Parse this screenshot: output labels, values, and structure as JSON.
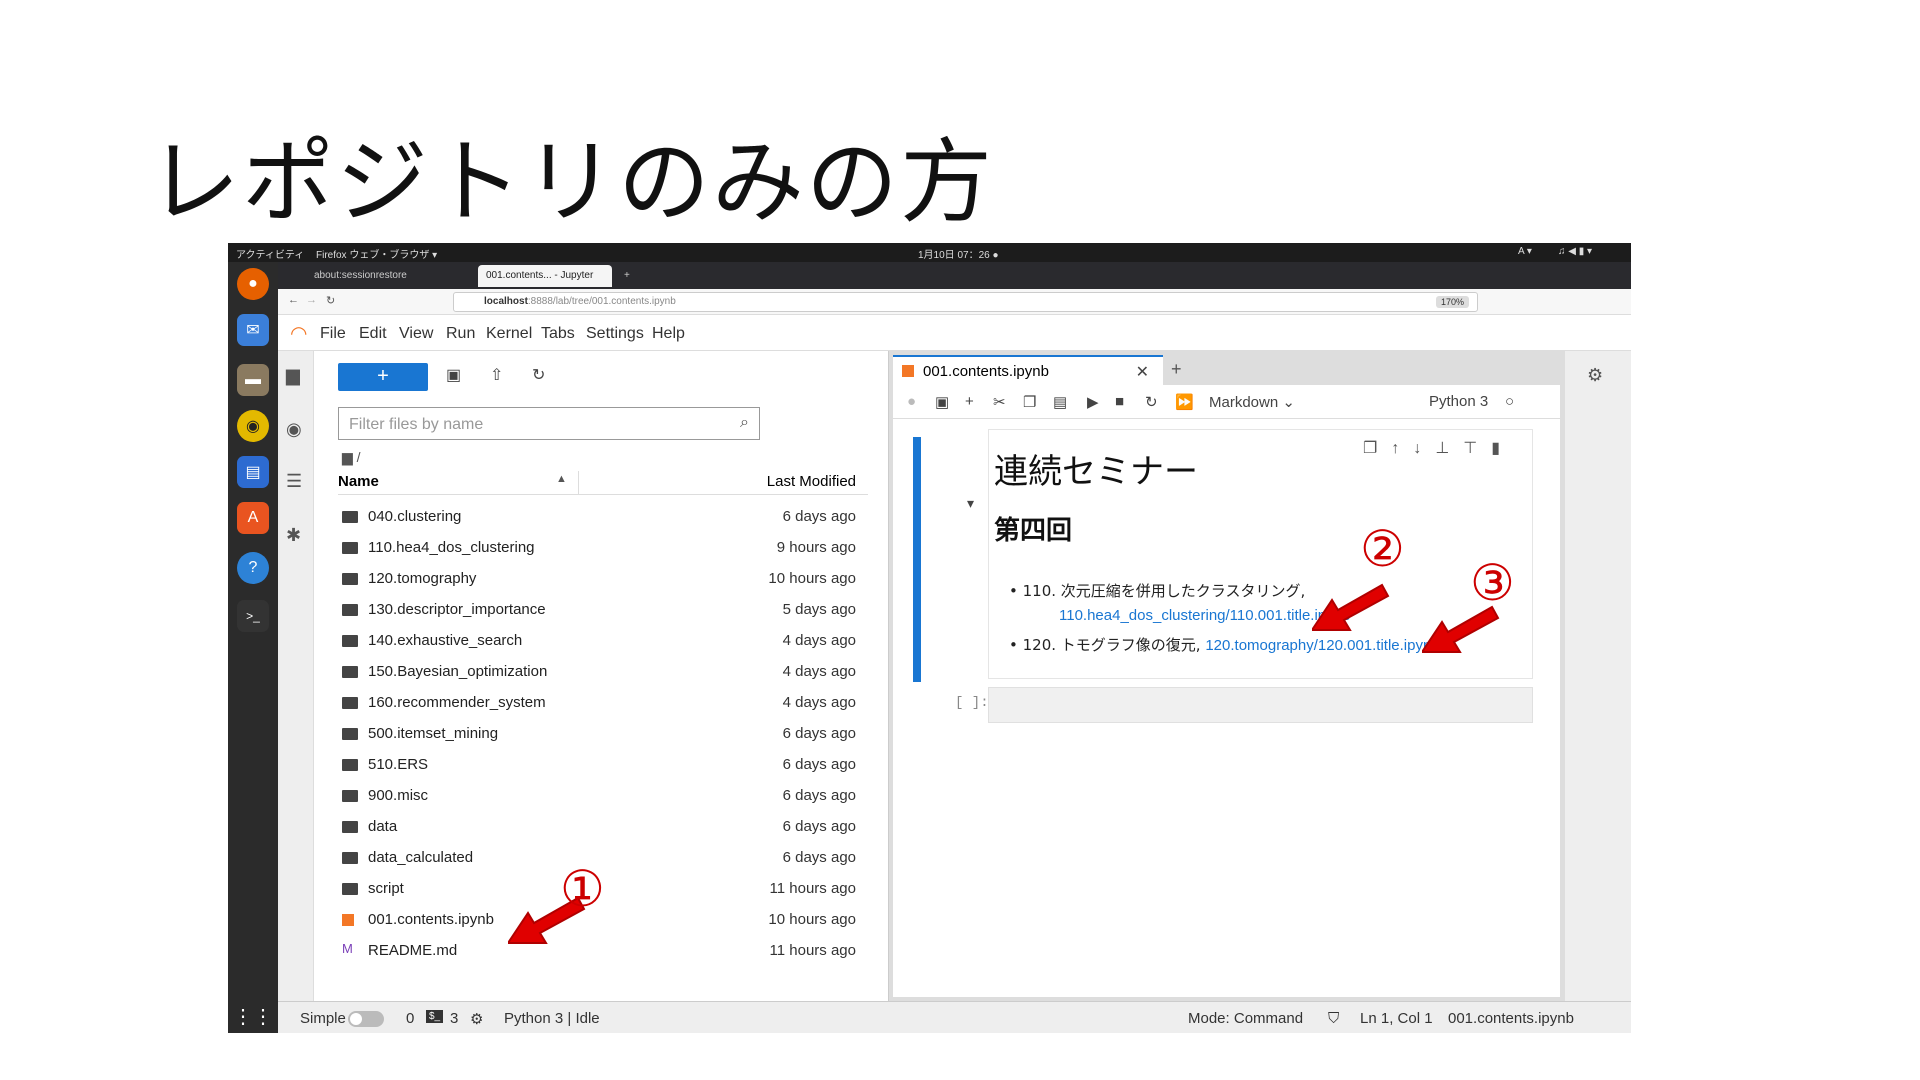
{
  "slide_title": "レポジトリのみの方",
  "gnome": {
    "activities": "アクティビティ",
    "app": "Firefox ウェブ・ブラウザ ▾",
    "clock": "1月10日 07：26 ●",
    "lang": "A ▾"
  },
  "firefox": {
    "tab1": "about:sessionrestore",
    "tab2": "001.contents... - Jupyter",
    "url_host": "localhost",
    "url_rest": ":8888/lab/tree/001.contents.ipynb",
    "zoom": "170%"
  },
  "menu": [
    "File",
    "Edit",
    "View",
    "Run",
    "Kernel",
    "Tabs",
    "Settings",
    "Help"
  ],
  "filebrowser": {
    "filter_placeholder": "Filter files by name",
    "crumb": "/",
    "col_name": "Name",
    "col_modified": "Last Modified",
    "rows": [
      {
        "name": "040.clustering",
        "date": "6 days ago",
        "type": "folder"
      },
      {
        "name": "110.hea4_dos_clustering",
        "date": "9 hours ago",
        "type": "folder"
      },
      {
        "name": "120.tomography",
        "date": "10 hours ago",
        "type": "folder"
      },
      {
        "name": "130.descriptor_importance",
        "date": "5 days ago",
        "type": "folder"
      },
      {
        "name": "140.exhaustive_search",
        "date": "4 days ago",
        "type": "folder"
      },
      {
        "name": "150.Bayesian_optimization",
        "date": "4 days ago",
        "type": "folder"
      },
      {
        "name": "160.recommender_system",
        "date": "4 days ago",
        "type": "folder"
      },
      {
        "name": "500.itemset_mining",
        "date": "6 days ago",
        "type": "folder"
      },
      {
        "name": "510.ERS",
        "date": "6 days ago",
        "type": "folder"
      },
      {
        "name": "900.misc",
        "date": "6 days ago",
        "type": "folder"
      },
      {
        "name": "data",
        "date": "6 days ago",
        "type": "folder"
      },
      {
        "name": "data_calculated",
        "date": "6 days ago",
        "type": "folder"
      },
      {
        "name": "script",
        "date": "11 hours ago",
        "type": "folder"
      },
      {
        "name": "001.contents.ipynb",
        "date": "10 hours ago",
        "type": "notebook"
      },
      {
        "name": "README.md",
        "date": "11 hours ago",
        "type": "markdown"
      }
    ]
  },
  "notebook": {
    "tab_title": "001.contents.ipynb",
    "cell_type": "Markdown",
    "kernel": "Python 3",
    "h1": "連続セミナー",
    "h2": "第四回",
    "item1_text": "• 110. 次元圧縮を併用したクラスタリング,",
    "item1_link": "110.hea4_dos_clustering/110.001.title.ipynb",
    "item2_text": "• 120. トモグラフ像の復元, ",
    "item2_link": "120.tomography/120.001.title.ipynb",
    "code_prompt": "[ ]:"
  },
  "status": {
    "mode_label": "Simple",
    "count1": "0",
    "count2": "3",
    "kernel_status": "Python 3 | Idle",
    "mode": "Mode: Command",
    "position": "Ln 1, Col 1",
    "file": "001.contents.ipynb"
  },
  "annotations": [
    "①",
    "②",
    "③"
  ],
  "colors": {
    "accent": "#1976d2",
    "annotation": "#e00000"
  }
}
